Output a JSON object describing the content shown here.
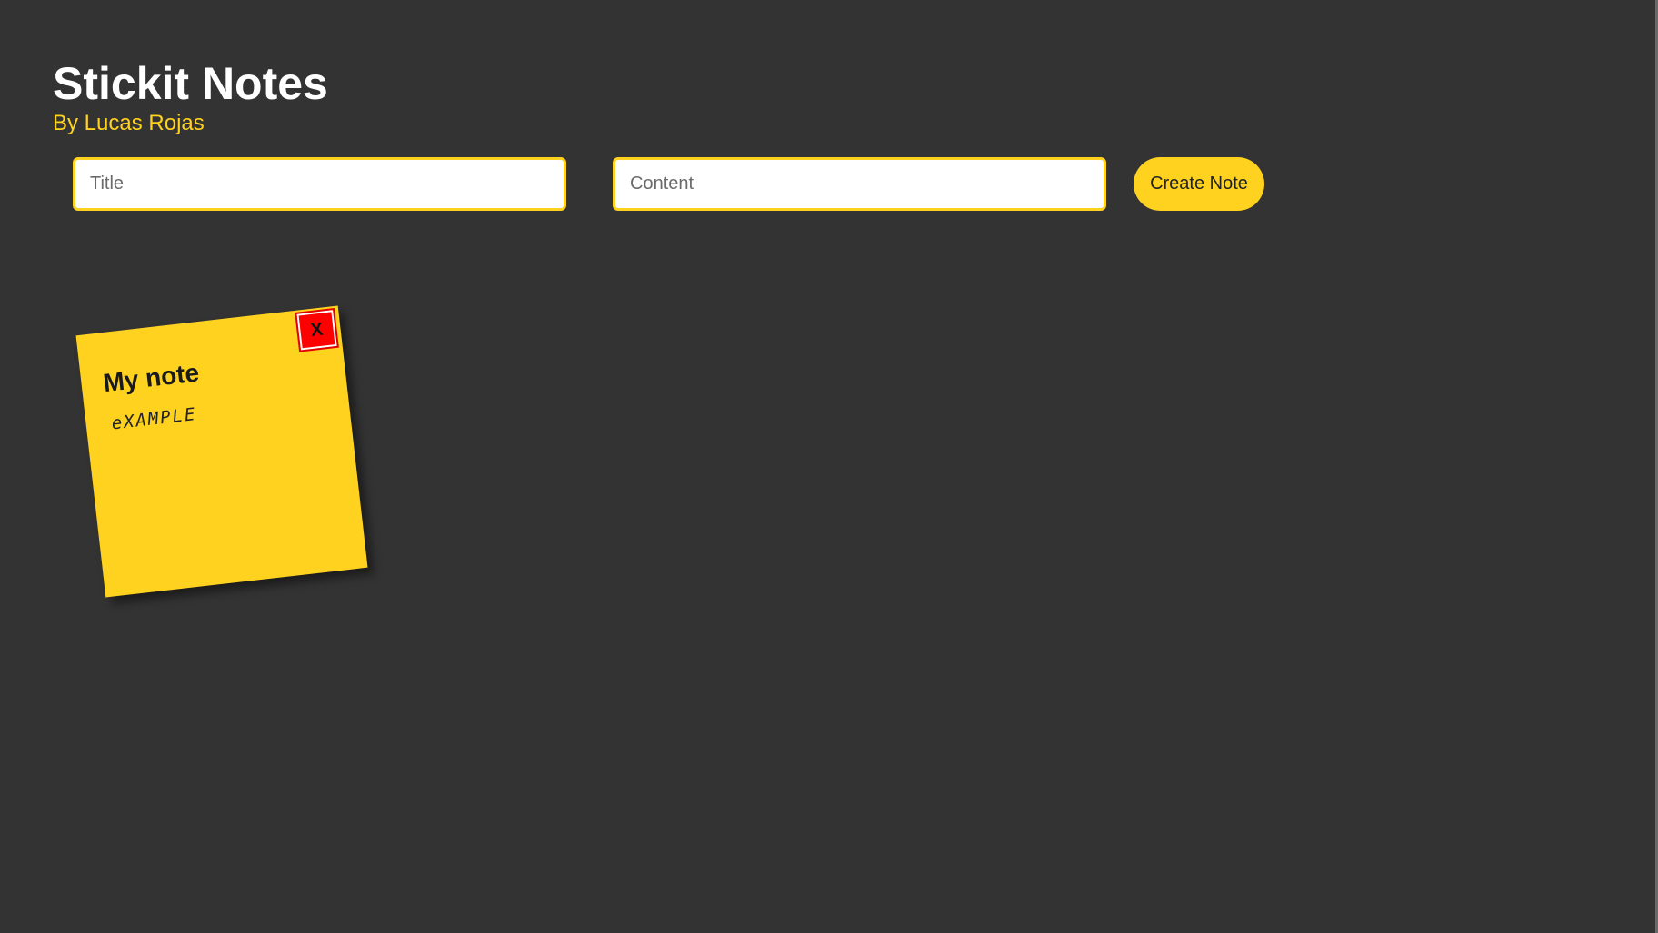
{
  "app": {
    "title": "Stickit Notes",
    "subtitle": "By Lucas Rojas"
  },
  "form": {
    "title_placeholder": "Title",
    "title_value": "",
    "content_placeholder": "Content",
    "content_value": "",
    "create_label": "Create Note"
  },
  "notes": [
    {
      "title": "My note",
      "content": "eXAMPLE",
      "delete_label": "X"
    }
  ],
  "colors": {
    "background": "#333333",
    "accent": "#ffd21f",
    "note": "#ffd21f",
    "delete": "#ff0000",
    "title_text": "#ffffff"
  }
}
